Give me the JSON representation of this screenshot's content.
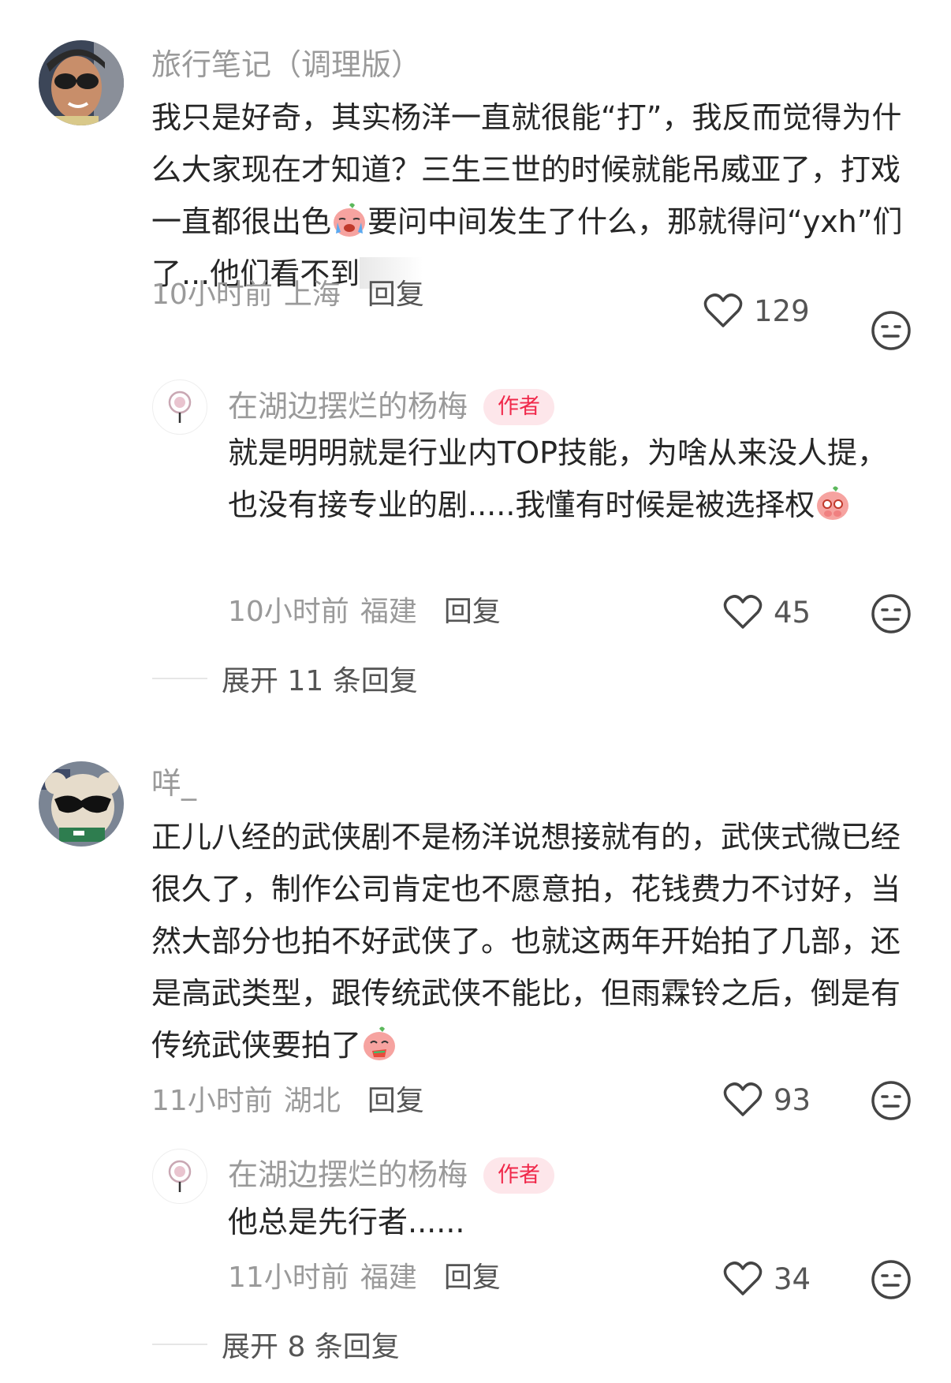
{
  "comments": [
    {
      "username": "旅行笔记（调理版）",
      "content_parts": [
        "我只是好奇，其实杨洋一直就很能“打”，我反而觉得为什么大家现在才知道？三生三世的时候就能吊威亚了，打戏一直都很出色",
        "要问中间发生了什么，那就得问“yxh”们了...他们看不到"
      ],
      "time": "10小时前",
      "location": "上海",
      "reply_label": "回复",
      "likes": "129",
      "reply": {
        "username": "在湖边摆烂的杨梅",
        "badge": "作者",
        "content": "就是明明就是行业内TOP技能，为啥从来没人提，也没有接专业的剧.....我懂有时候是被选择权",
        "time": "10小时前",
        "location": "福建",
        "reply_label": "回复",
        "likes": "45"
      },
      "expand_label": "展开 11 条回复"
    },
    {
      "username": "咩_",
      "content": "正儿八经的武侠剧不是杨洋说想接就有的，武侠式微已经很久了，制作公司肯定也不愿意拍，花钱费力不讨好，当然大部分也拍不好武侠了。也就这两年开始拍了几部，还是高武类型，跟传统武侠不能比，但雨霖铃之后，倒是有传统武侠要拍了",
      "time": "11小时前",
      "location": "湖北",
      "reply_label": "回复",
      "likes": "93",
      "reply": {
        "username": "在湖边摆烂的杨梅",
        "badge": "作者",
        "content": "他总是先行者......",
        "time": "11小时前",
        "location": "福建",
        "reply_label": "回复",
        "likes": "34"
      },
      "expand_label": "展开 8 条回复"
    }
  ],
  "icons": {
    "like": "heart-outline-icon",
    "dislike": "meh-face-icon",
    "emoji_cry": "crying-peach-emoji",
    "emoji_shy": "shy-peach-emoji",
    "emoji_eat": "eating-peach-emoji"
  }
}
